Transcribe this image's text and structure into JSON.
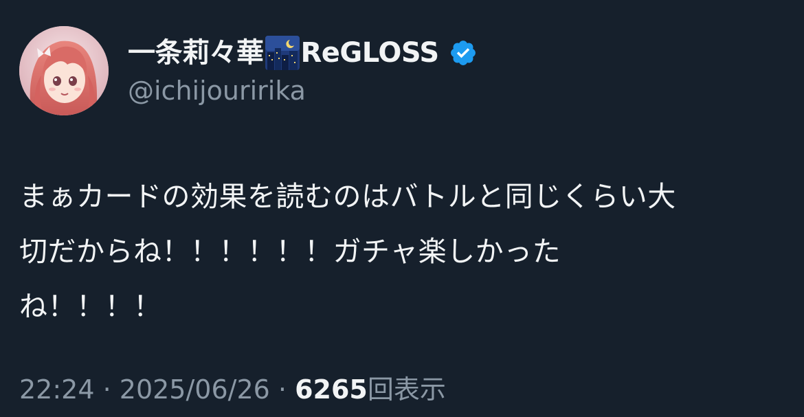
{
  "tweet": {
    "author": {
      "display_name": "一条莉々華",
      "name_emoji": "city-night-icon",
      "group_name": "ReGLOSS",
      "verified": true,
      "verified_color": "#1d9bf0",
      "handle": "@ichijouririka"
    },
    "text_lines": [
      "まぁカードの効果を読むのはバトルと同じくらい大",
      "切だからね！！！！！！ガチャ楽しかった",
      "ね！！！！"
    ],
    "meta": {
      "time": "22:24",
      "separator1": "·",
      "date": "2025/06/26",
      "separator2": "·",
      "views_count": "6265",
      "views_label": "回表示"
    }
  },
  "colors": {
    "background": "#16202c",
    "text_primary": "#f2f4f5",
    "text_secondary": "#8b98a5"
  }
}
